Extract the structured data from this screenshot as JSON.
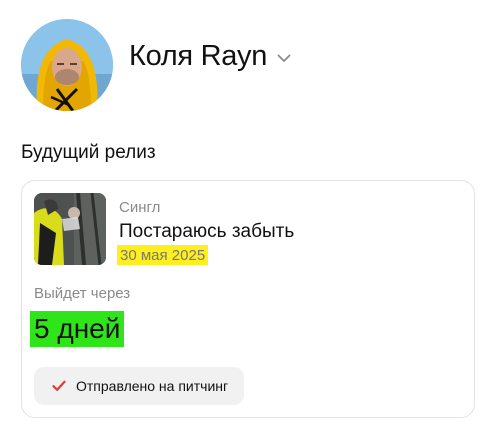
{
  "profile": {
    "name": "Коля Rayn",
    "avatar_icon": "user-avatar-photo",
    "dropdown_icon": "chevron-down-icon"
  },
  "section": {
    "title": "Будущий релиз"
  },
  "release": {
    "type": "Сингл",
    "title": "Постараюсь забыть",
    "date": "30 мая 2025",
    "date_highlight_color": "#ffef1f",
    "cover_icon": "album-cover-image",
    "countdown_label": "Выйдет через",
    "countdown_value": "5 дней",
    "countdown_highlight_color": "#2ee51a",
    "status": {
      "label": "Отправлено на питчинг",
      "icon": "check-icon",
      "icon_color": "#e53935"
    }
  }
}
